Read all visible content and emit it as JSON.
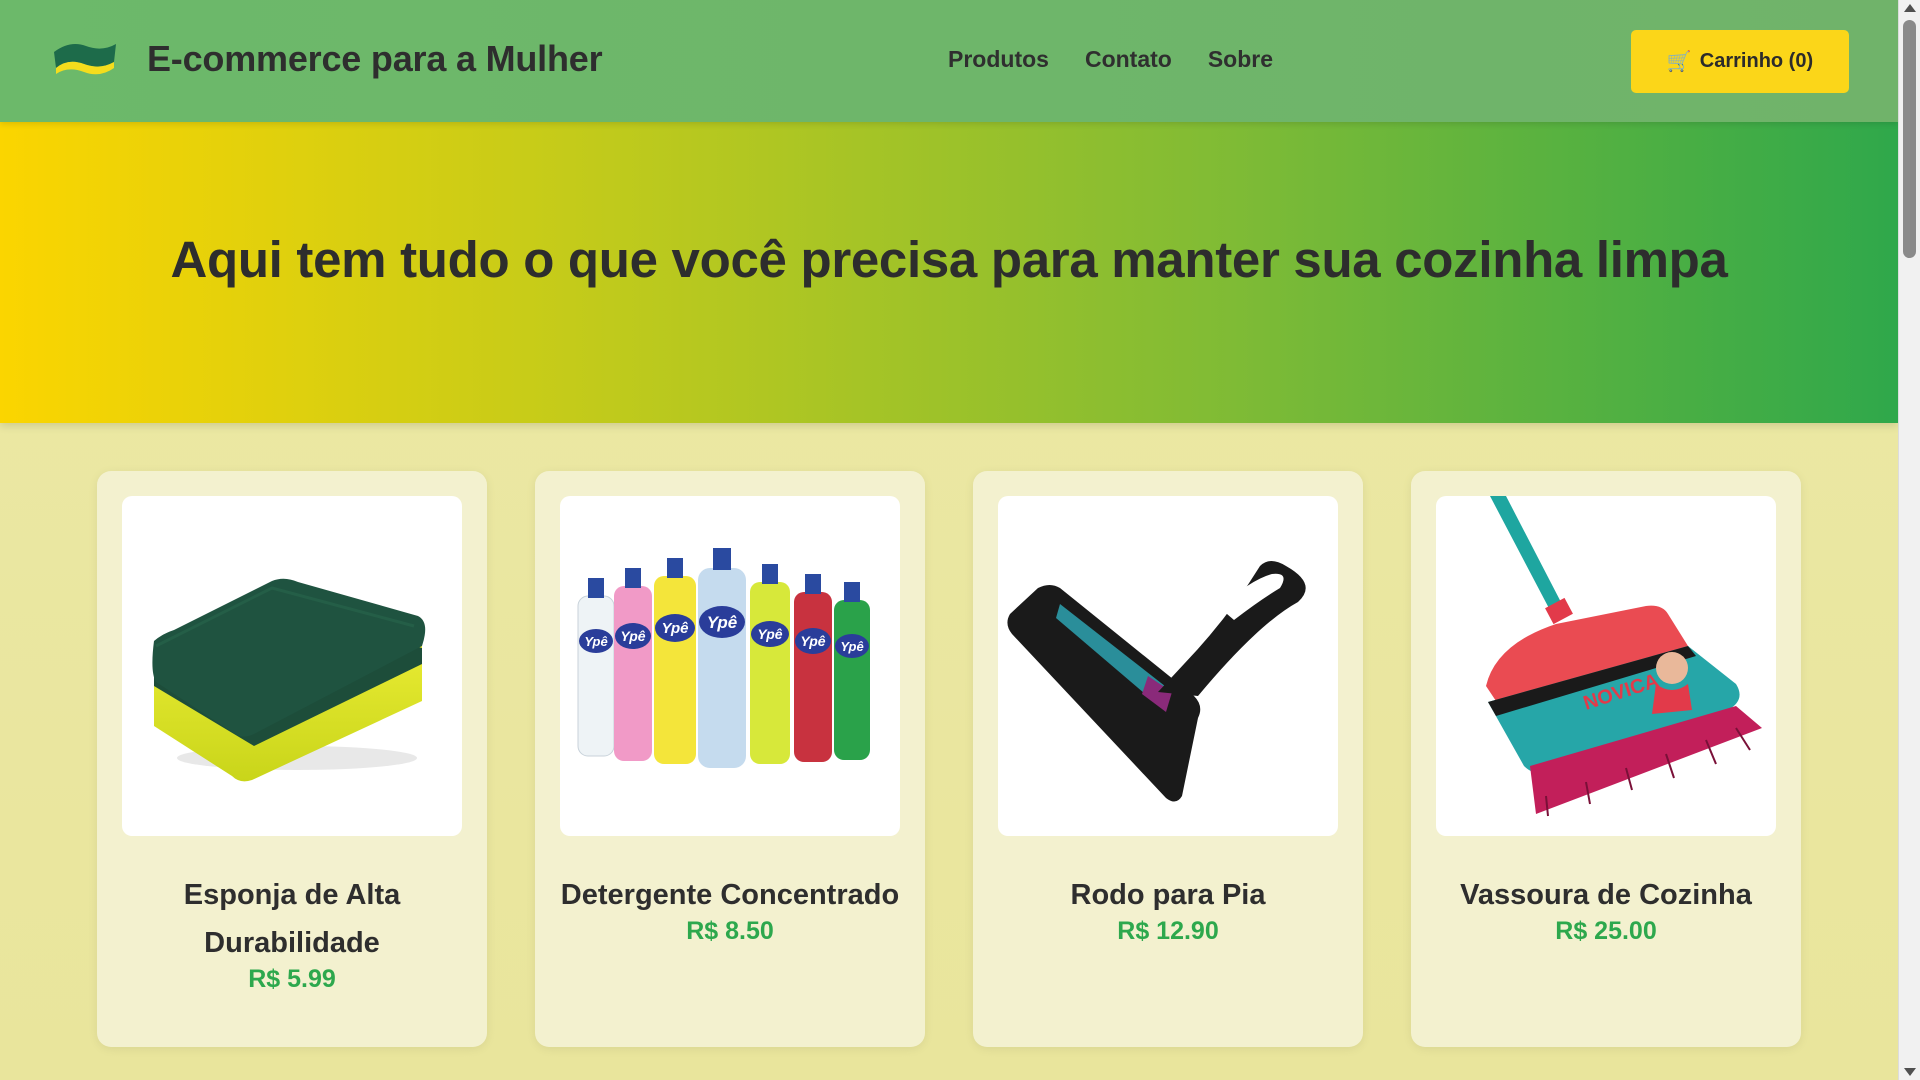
{
  "header": {
    "brand": "E-commerce para a Mulher",
    "logo_icon": "sponge-logo-icon",
    "nav": [
      "Produtos",
      "Contato",
      "Sobre"
    ],
    "cart_icon": "shopping-cart-icon",
    "cart_label": "Carrinho (0)"
  },
  "hero": {
    "title": "Aqui tem tudo o que você precisa para manter sua cozinha limpa"
  },
  "products": [
    {
      "name": "Esponja de Alta Durabilidade",
      "price": "R$ 5.99",
      "image": "sponge-image"
    },
    {
      "name": "Detergente Concentrado",
      "price": "R$ 8.50",
      "image": "detergent-bottles-image"
    },
    {
      "name": "Rodo para Pia",
      "price": "R$ 12.90",
      "image": "sink-squeegee-image"
    },
    {
      "name": "Vassoura de Cozinha",
      "price": "R$ 25.00",
      "image": "kitchen-broom-image"
    }
  ],
  "colors": {
    "header_green": "#6cb96a",
    "accent_yellow": "#fbd619",
    "price_green": "#2da84d",
    "page_bg": "#ebe8a2",
    "card_bg": "#f3f1cf"
  }
}
